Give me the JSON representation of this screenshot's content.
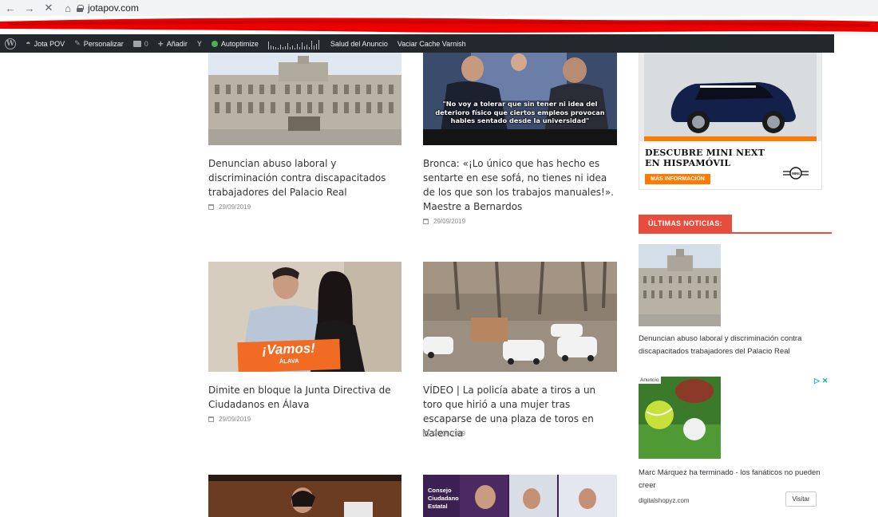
{
  "browser": {
    "back_icon": "arrow-left-icon",
    "forward_icon": "arrow-right-icon",
    "stop_icon": "close-icon",
    "home_icon": "home-icon",
    "url": "jotapov.com"
  },
  "adminbar": {
    "site_name": "Jota POV",
    "customize": "Personalizar",
    "comments_count": "0",
    "add_new": "Añadir",
    "autoptimize": "Autoptimize",
    "ad_health": "Salud del Anuncio",
    "varnish": "Vaciar Cache Varnish"
  },
  "posts": [
    {
      "title": "Denuncian abuso laboral y discriminación contra discapacitados trabajadores del Palacio Real",
      "date": "29/09/2019"
    },
    {
      "title": "Bronca: «¡Lo único que has hecho es sentarte en ese sofá, no tienes ni idea de los que son los trabajos manuales!». Maestre a Bernardos",
      "date": "29/09/2019",
      "image_caption": "\"No voy a tolerar que sin tener ni idea del deterioro físico que ciertos empleos provocan hables sentado desde la universidad\""
    },
    {
      "title": "Dimite en bloque la Junta Directiva de Ciudadanos en Álava",
      "date": "29/09/2019",
      "sign_line1": "¡Vamos!",
      "sign_line2": "ÁLAVA"
    },
    {
      "title": "VÍDEO | La policía abate a tiros a un toro que hirió a una mujer tras escaparse de una plaza de toros en Valencia",
      "date": "28/09/2019"
    }
  ],
  "bottom_card_label": "Consejo Ciudadano Estatal",
  "sidebar": {
    "ad": {
      "headline_1": "DESCUBRE MINI NEXT",
      "headline_2": "EN HISPAMÓVIL",
      "cta": "MÁS INFORMACIÓN",
      "logo_text": "MINI"
    },
    "latest_heading": "ÚLTIMAS NOTICIAS:",
    "latest_item": "Denuncian abuso laboral y discriminación contra discapacitados trabajadores del Palacio Real",
    "sponsored": {
      "badge": "Anuncio",
      "title": "Marc Márquez ha terminado - los fanáticos no pueden creer",
      "domain": "digitalshopyz.com",
      "visit": "Visitar"
    }
  },
  "colors": {
    "accent": "#e74c3c",
    "adminbar": "#23282d",
    "mini_orange": "#ff7a00",
    "sign_orange": "#f26b22"
  }
}
